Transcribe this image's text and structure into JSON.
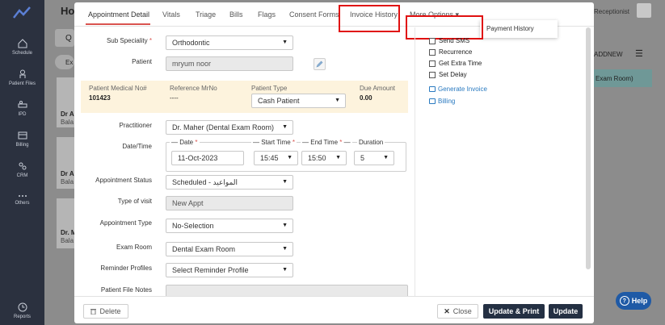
{
  "app": {
    "title": "Ho",
    "header_role": "Receptionist",
    "nav": [
      {
        "label": "Schedule",
        "icon": "home-icon"
      },
      {
        "label": "Patient Files",
        "icon": "person-icon"
      },
      {
        "label": "IPD",
        "icon": "bed-icon"
      },
      {
        "label": "Billing",
        "icon": "billing-icon"
      },
      {
        "label": "CRM",
        "icon": "crm-icon"
      },
      {
        "label": "Others",
        "icon": "more-icon"
      },
      {
        "label": "Reports",
        "icon": "reports-icon"
      }
    ],
    "bg": {
      "ex": "Ex",
      "addnew": "ADDNEW",
      "exam_room": "Exam Room)",
      "card1_name": "Dr A",
      "card1_sub": "Bala",
      "card2_name": "Dr A",
      "card2_sub": "Bala",
      "card3_name": "Dr. M",
      "card3_sub": "Bala"
    },
    "help_label": "Help"
  },
  "modal": {
    "tabs": [
      {
        "label": "Appointment Detail",
        "active": true
      },
      {
        "label": "Vitals"
      },
      {
        "label": "Triage"
      },
      {
        "label": "Bills"
      },
      {
        "label": "Flags"
      },
      {
        "label": "Consent Forms"
      },
      {
        "label": "Invoice History"
      },
      {
        "label": "More Options"
      }
    ],
    "more_menu_item": "Payment History",
    "form": {
      "sub_speciality_label": "Sub Speciality",
      "sub_speciality_value": "Orthodontic",
      "patient_label": "Patient",
      "patient_value": "mryum  noor",
      "medical_no_label": "Patient Medical No#",
      "medical_no_value": "101423",
      "reference_label": "Reference MrNo",
      "reference_value": "----",
      "patient_type_label": "Patient Type",
      "patient_type_value": "Cash Patient",
      "due_label": "Due Amount",
      "due_value": "0.00",
      "practitioner_label": "Practitioner",
      "practitioner_value": "Dr. Maher (Dental Exam Room)",
      "datetime_label": "Date/Time",
      "date_legend": "Date",
      "date_value": "11-Oct-2023",
      "start_legend": "Start Time",
      "start_value": "15:45",
      "end_legend": "End Time",
      "end_value": "15:50",
      "duration_legend": "Duration",
      "duration_value": "5",
      "status_label": "Appointment Status",
      "status_value": "Scheduled - المواعيد",
      "visit_label": "Type of visit",
      "visit_value": "New Appt",
      "appt_type_label": "Appointment Type",
      "appt_type_value": "No-Selection",
      "exam_room_label": "Exam Room",
      "exam_room_value": "Dental Exam Room",
      "reminder_label": "Reminder Profiles",
      "reminder_value": "Select Reminder Profile",
      "notes_label": "Patient File Notes"
    },
    "options": {
      "send_sms": "Send SMS",
      "recurrence": "Recurrence",
      "extra_time": "Get Extra Time",
      "set_delay": "Set Delay",
      "generate_invoice": "Generate Invoice",
      "billing": "Billing"
    },
    "footer": {
      "delete": "Delete",
      "close": "Close",
      "update_print": "Update & Print",
      "update": "Update"
    }
  }
}
